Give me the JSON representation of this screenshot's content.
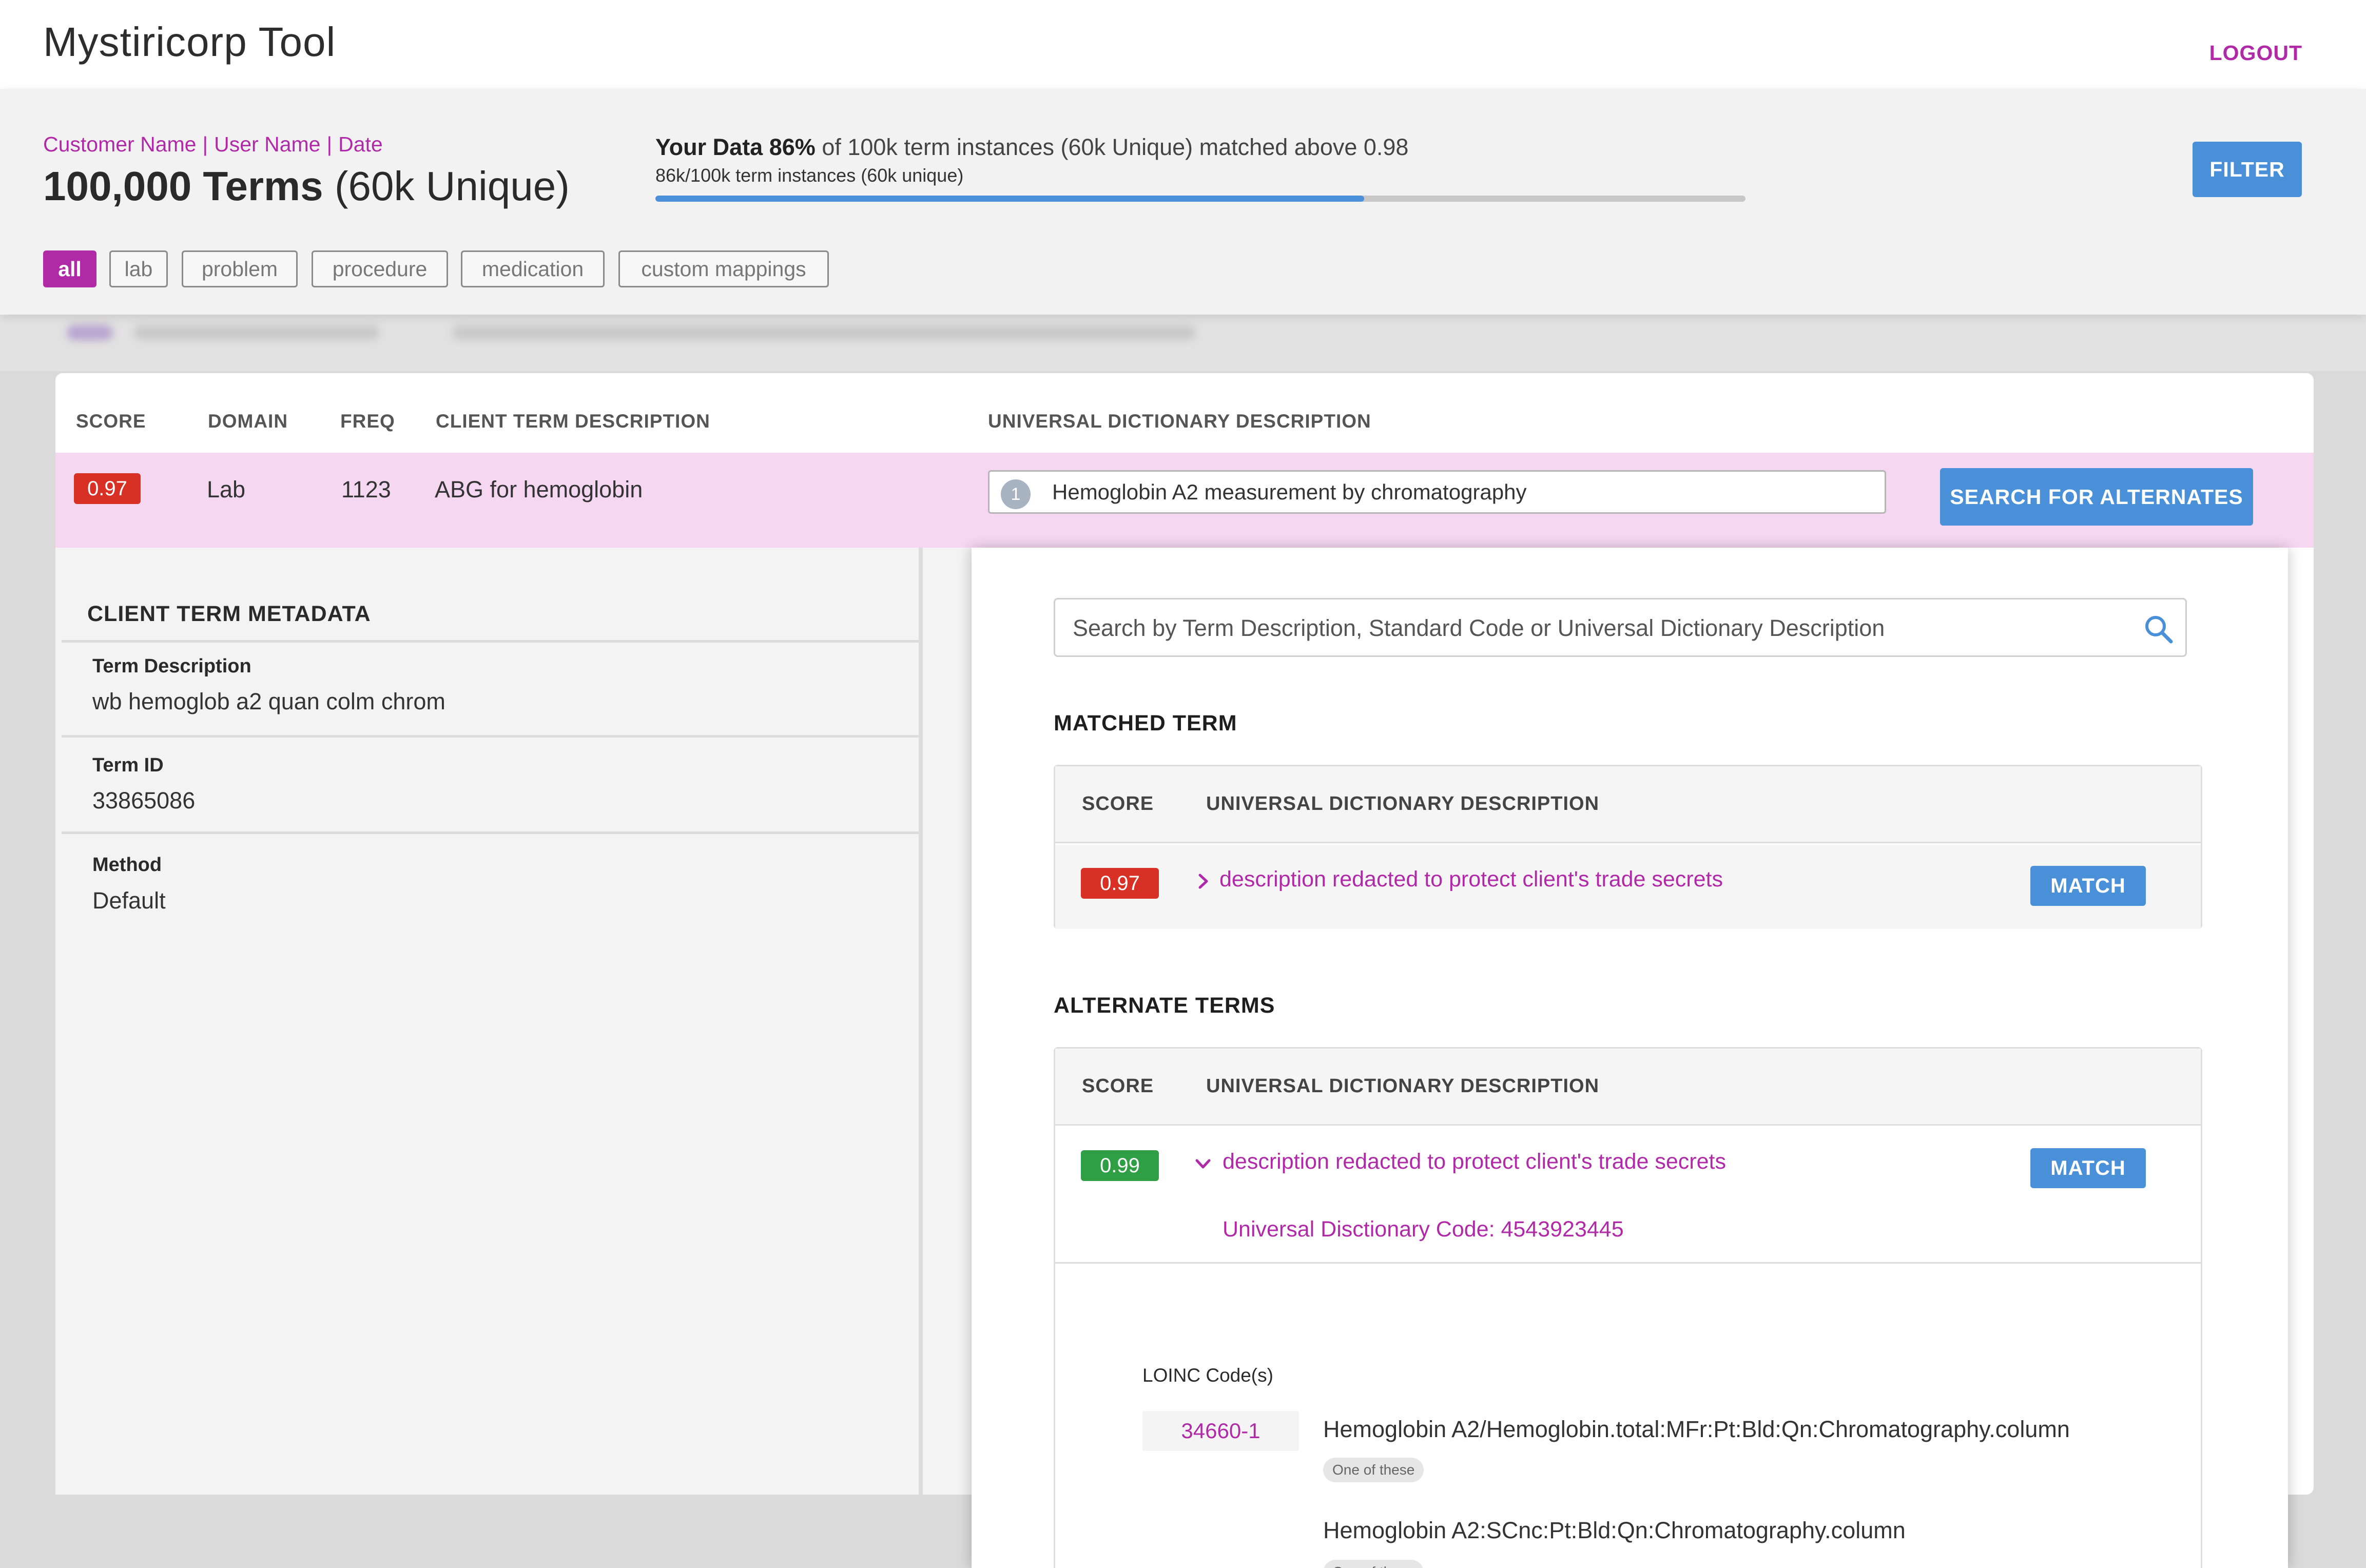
{
  "app": {
    "title": "Mystiricorp Tool",
    "logout_label": "LOGOUT"
  },
  "summary": {
    "customer": "Customer Name",
    "user": "User Name",
    "date": "Date",
    "separator": "|",
    "terms_count": "100,000 Terms",
    "unique": "(60k Unique)",
    "your_data_label": "Your Data",
    "matched_percent": "86%",
    "data_text": "of 100k term instances (60k Unique)  matched above 0.98",
    "sub_text": "86k/100k term instances (60k unique)",
    "progress_fraction": 0.65,
    "filter_label": "FILTER"
  },
  "filters": {
    "chips": [
      {
        "label": "all",
        "active": true
      },
      {
        "label": "lab",
        "active": false
      },
      {
        "label": "problem",
        "active": false
      },
      {
        "label": "procedure",
        "active": false
      },
      {
        "label": "medication",
        "active": false
      },
      {
        "label": "custom mappings",
        "active": false
      }
    ]
  },
  "table": {
    "headers": {
      "score": "SCORE",
      "domain": "DOMAIN",
      "freq": "FREQ",
      "client_desc": "CLIENT TERM DESCRIPTION",
      "ud_desc": "UNIVERSAL DICTIONARY DESCRIPTION"
    },
    "selected_row": {
      "score": "0.97",
      "domain": "Lab",
      "freq": "1123",
      "client_desc": "ABG for hemoglobin",
      "ud_badge": "1",
      "ud_desc": "Hemoglobin A2 measurement by chromatography",
      "search_alternates_label": "SEARCH FOR ALTERNATES"
    }
  },
  "metadata": {
    "title": "CLIENT TERM METADATA",
    "fields": [
      {
        "label": "Term Description",
        "value": "wb hemoglob a2 quan colm chrom"
      },
      {
        "label": "Term ID",
        "value": "33865086"
      },
      {
        "label": "Method",
        "value": "Default"
      }
    ]
  },
  "detail": {
    "search_placeholder": "Search by Term Description, Standard Code or Universal Dictionary Description",
    "matched_section": {
      "title": "MATCHED TERM",
      "headers": {
        "score": "SCORE",
        "ud_desc": "UNIVERSAL DICTIONARY DESCRIPTION"
      },
      "row": {
        "score": "0.97",
        "desc": "description redacted to protect client's trade secrets",
        "match_label": "MATCH"
      }
    },
    "alternate_section": {
      "title": "ALTERNATE TERMS",
      "headers": {
        "score": "SCORE",
        "ud_desc": "UNIVERSAL DICTIONARY DESCRIPTION"
      },
      "row": {
        "score": "0.99",
        "desc": "description redacted to protect client's trade secrets",
        "match_label": "MATCH",
        "ud_code": "Universal Disctionary Code: 4543923445"
      },
      "loinc": {
        "label": "LOINC Code(s)",
        "code": "34660-1",
        "items": [
          {
            "desc": "Hemoglobin A2/Hemoglobin.total:MFr:Pt:Bld:Qn:Chromatography.column",
            "pill": "One of these"
          },
          {
            "desc": "Hemoglobin A2:SCnc:Pt:Bld:Qn:Chromatography.column",
            "pill": "One of these"
          }
        ]
      }
    }
  },
  "colors": {
    "accent": "#b02aa8",
    "primary_button": "#4a90d9",
    "score_low": "#d93025",
    "score_high": "#2f9e44",
    "selected_row": "#f6d7f2"
  }
}
